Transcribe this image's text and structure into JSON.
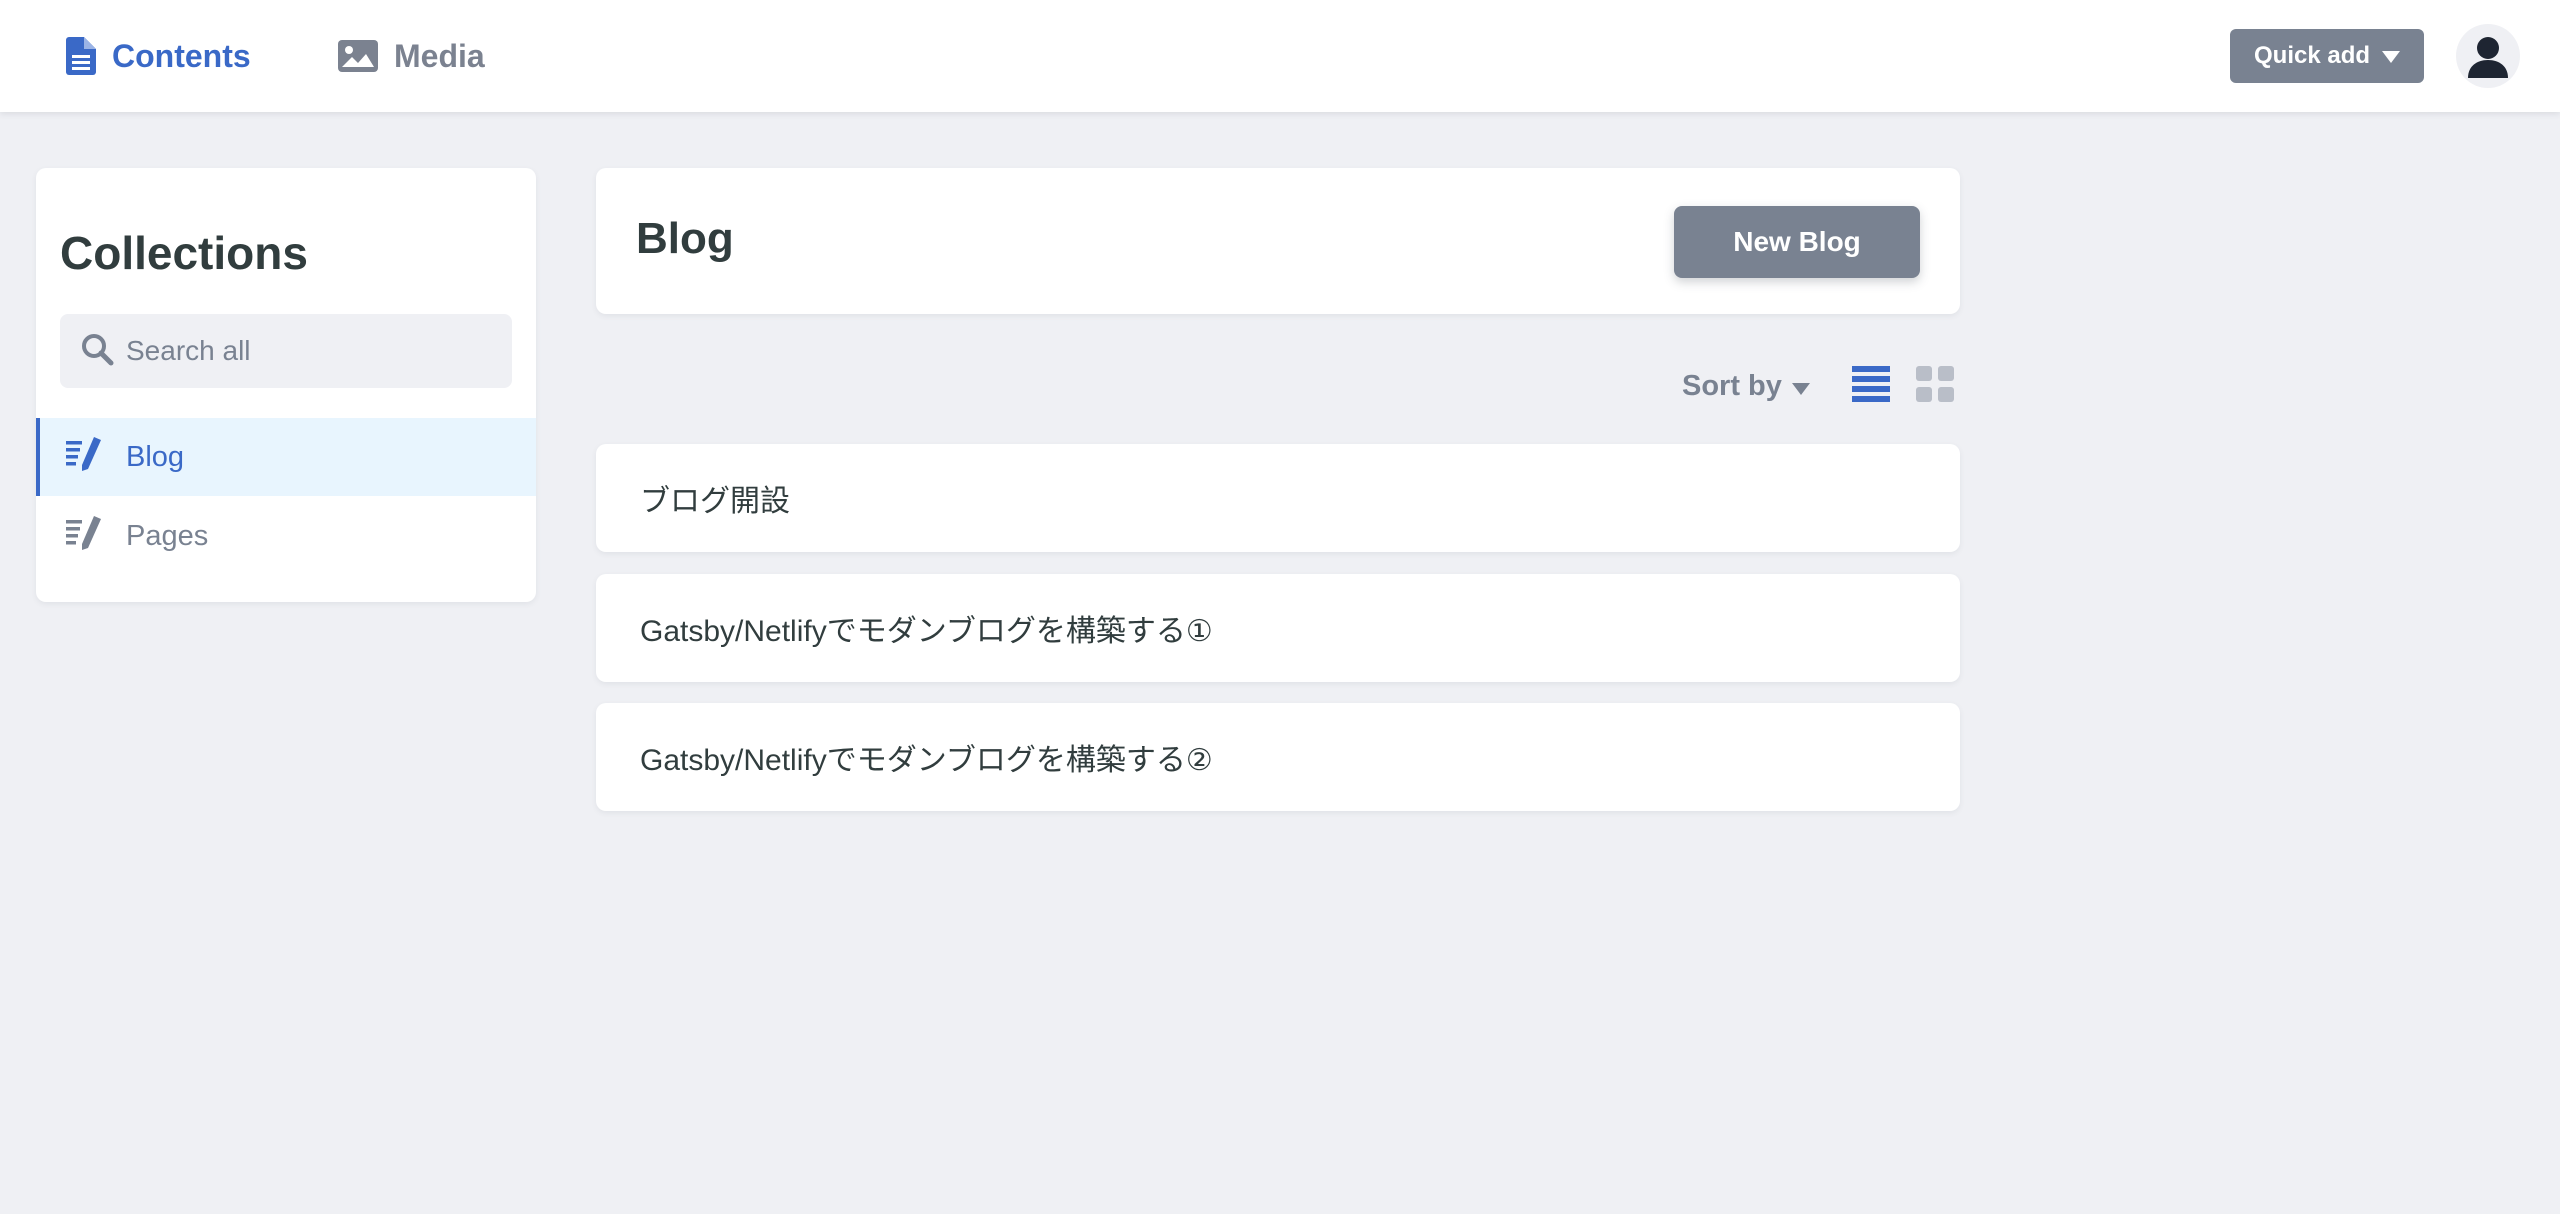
{
  "topbar": {
    "nav": [
      {
        "label": "Contents",
        "icon": "document-icon",
        "active": true
      },
      {
        "label": "Media",
        "icon": "image-icon",
        "active": false
      }
    ],
    "quick_add_label": "Quick add"
  },
  "sidebar": {
    "title": "Collections",
    "search_placeholder": "Search all",
    "items": [
      {
        "label": "Blog",
        "icon": "edit-list-icon",
        "active": true
      },
      {
        "label": "Pages",
        "icon": "edit-list-icon",
        "active": false
      }
    ]
  },
  "main": {
    "title": "Blog",
    "new_button_label": "New Blog",
    "sort_label": "Sort by",
    "view_modes": [
      "list",
      "grid"
    ],
    "active_view": "list",
    "entries": [
      "ブログ開設",
      "Gatsby/Netlifyでモダンブログを構築する①",
      "Gatsby/Netlifyでモダンブログを構築する②"
    ]
  },
  "colors": {
    "accent": "#3a69c7",
    "button_gray": "#798291",
    "text_dark": "#313d3e",
    "background": "#eff0f4",
    "active_item_bg": "#e8f5fe"
  }
}
